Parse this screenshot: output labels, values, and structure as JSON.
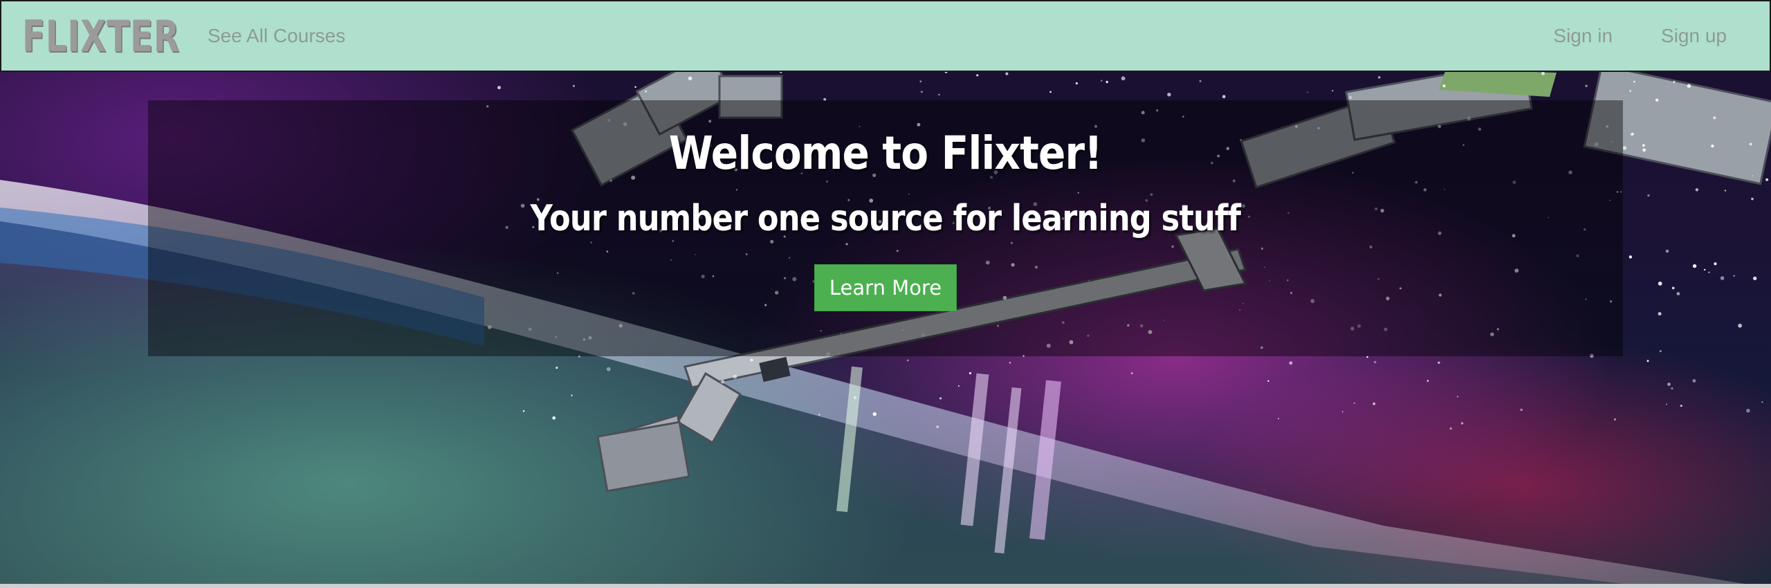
{
  "navbar": {
    "brand": "FLIXTER",
    "see_all_courses": "See All Courses",
    "sign_in": "Sign in",
    "sign_up": "Sign up",
    "background_color": "#aee0cd"
  },
  "hero": {
    "title": "Welcome to Flixter!",
    "subtitle": "Your number one source for learning stuff",
    "cta_label": "Learn More",
    "cta_color": "#4cb050",
    "background_image": "space-station-aurora"
  }
}
